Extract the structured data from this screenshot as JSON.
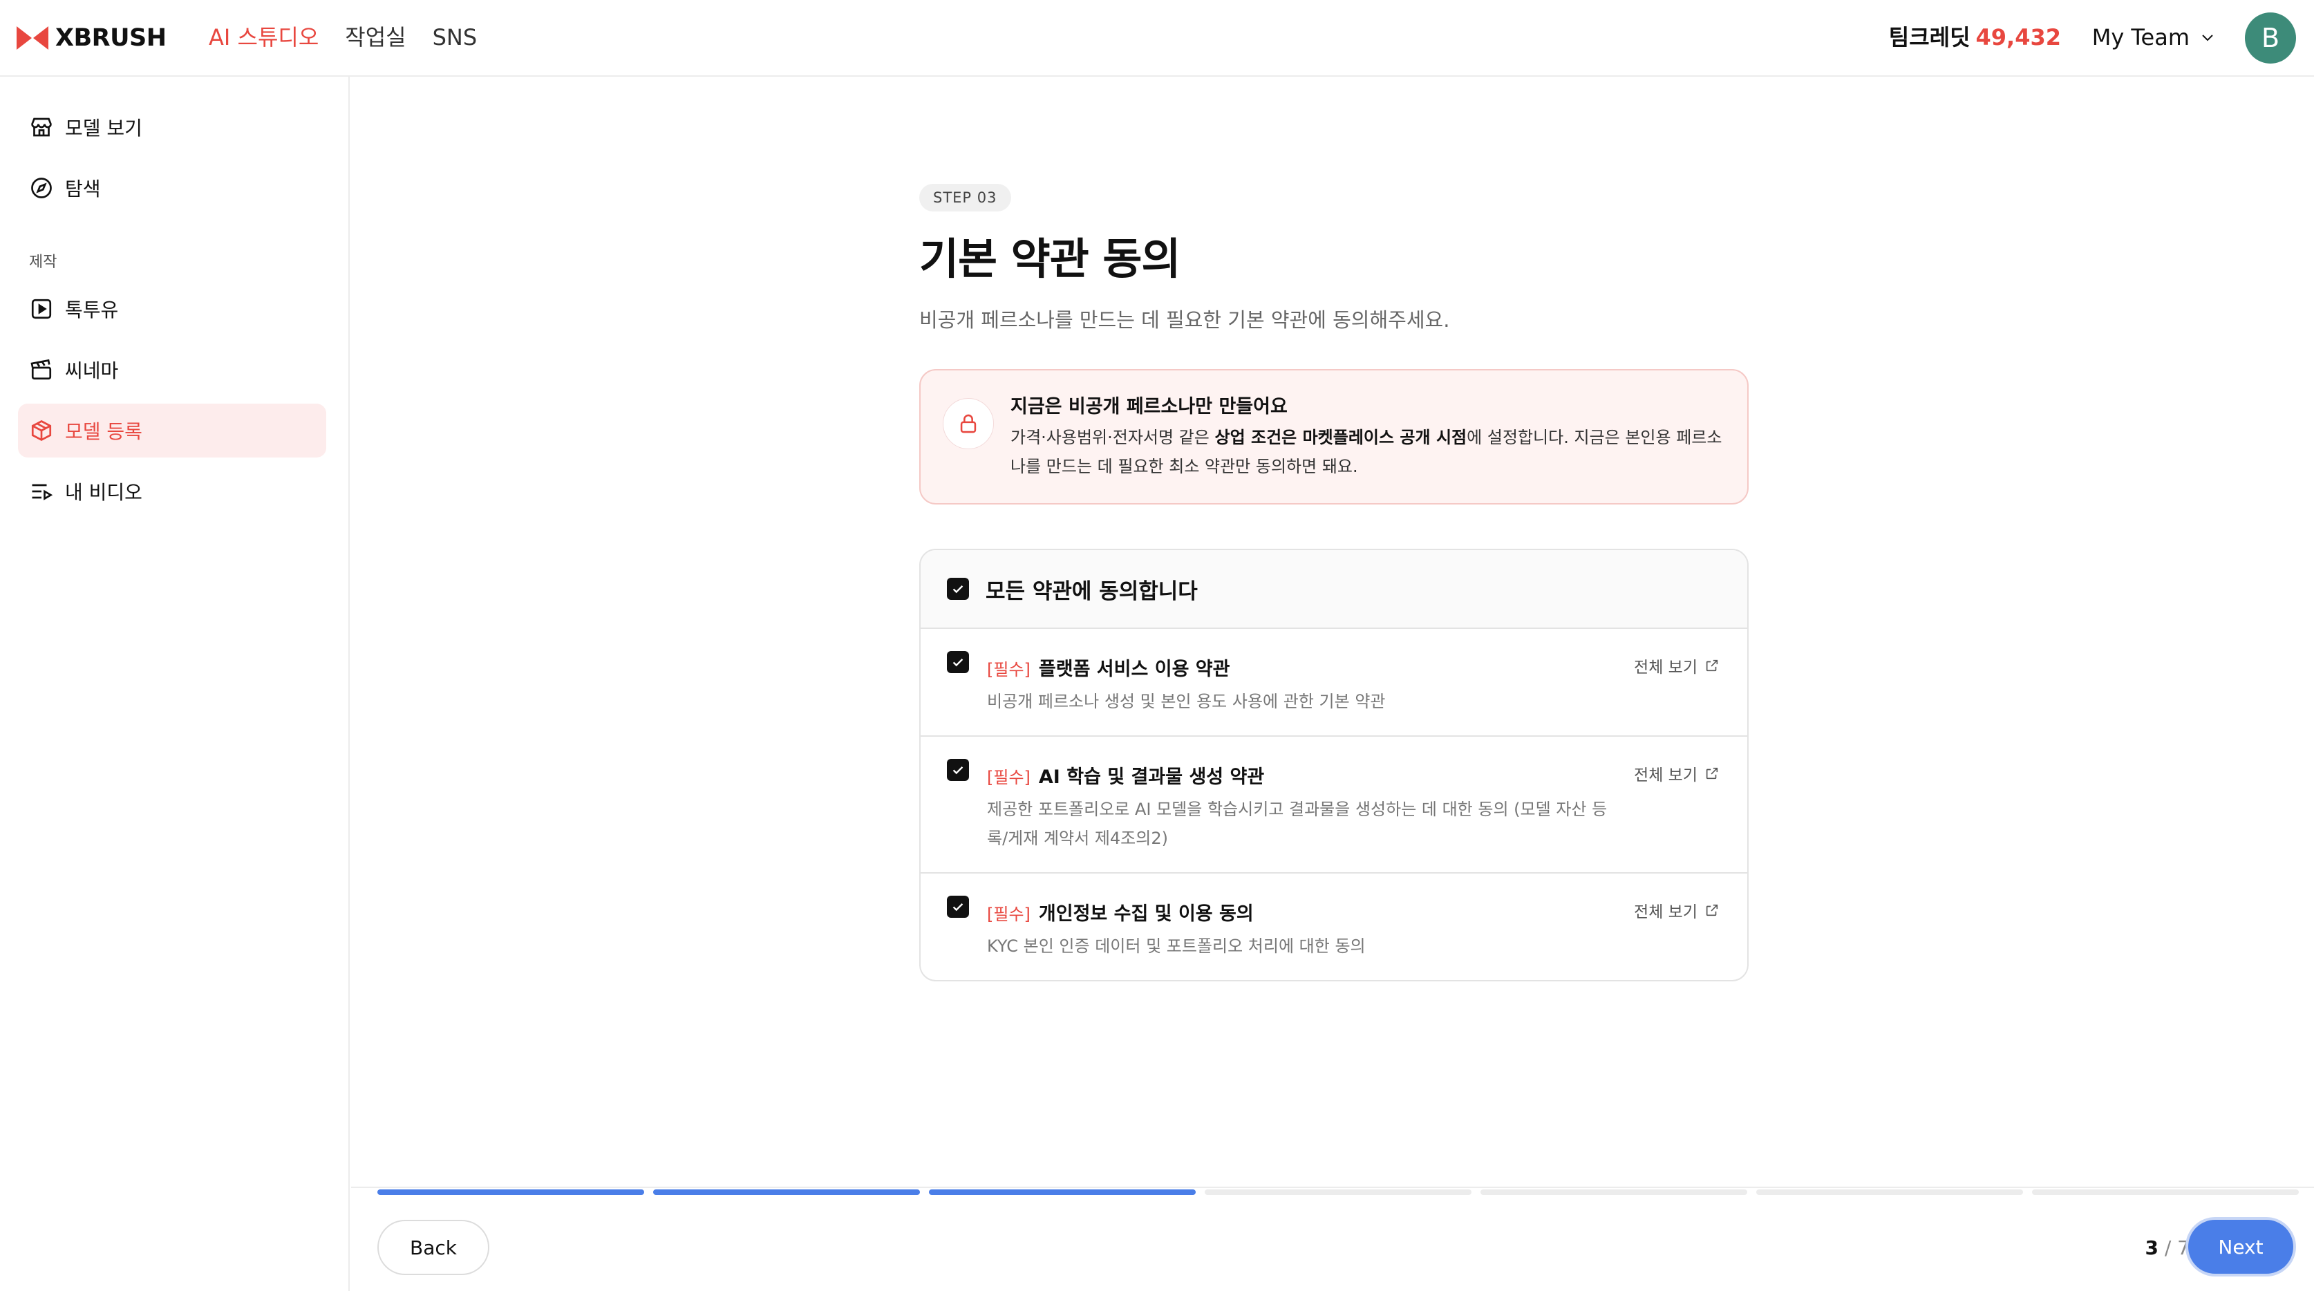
{
  "brand": {
    "name": "XBRUSH",
    "accent": "#e8473f",
    "primary": "#4a7ee8"
  },
  "header": {
    "nav": [
      {
        "label": "AI 스튜디오",
        "active": true
      },
      {
        "label": "작업실",
        "active": false
      },
      {
        "label": "SNS",
        "active": false
      }
    ],
    "credit_label": "팀크레딧",
    "credit_value": "49,432",
    "team_label": "My Team",
    "avatar_initial": "B"
  },
  "sidebar": {
    "items": [
      {
        "label": "모델 보기",
        "icon": "store-icon"
      },
      {
        "label": "탐색",
        "icon": "compass-icon"
      }
    ],
    "section_label": "제작",
    "make_items": [
      {
        "label": "톡투유",
        "icon": "play-square-icon"
      },
      {
        "label": "씨네마",
        "icon": "clapperboard-icon"
      },
      {
        "label": "모델 등록",
        "icon": "box-icon",
        "active": true
      },
      {
        "label": "내 비디오",
        "icon": "video-list-icon"
      }
    ]
  },
  "main": {
    "step_badge": "STEP 03",
    "title": "기본 약관 동의",
    "subtitle": "비공개 페르소나를 만드는 데 필요한 기본 약관에 동의해주세요.",
    "notice": {
      "title": "지금은 비공개 페르소나만 만들어요",
      "body_pre": "가격·사용범위·전자서명 같은 ",
      "body_bold": "상업 조건은 마켓플레이스 공개 시점",
      "body_post": "에 설정합니다. 지금은 본인용 페르소나를 만드는 데 필요한 최소 약관만 동의하면 돼요."
    },
    "agree_all_label": "모든 약관에 동의합니다",
    "view_all_label": "전체 보기",
    "terms": [
      {
        "required_tag": "[필수]",
        "title": "플랫폼 서비스 이용 약관",
        "desc": "비공개 페르소나 생성 및 본인 용도 사용에 관한 기본 약관",
        "checked": true
      },
      {
        "required_tag": "[필수]",
        "title": "AI 학습 및 결과물 생성 약관",
        "desc": "제공한 포트폴리오로 AI 모델을 학습시키고 결과물을 생성하는 데 대한 동의 (모델 자산 등록/게재 계약서 제4조의2)",
        "checked": true
      },
      {
        "required_tag": "[필수]",
        "title": "개인정보 수집 및 이용 동의",
        "desc": "KYC 본인 인증 데이터 및 포트폴리오 처리에 대한 동의",
        "checked": true
      }
    ]
  },
  "footer": {
    "back_label": "Back",
    "next_label": "Next",
    "current_step": "3",
    "total_steps_text": " / 7",
    "progress": {
      "total": 7,
      "done": 3
    }
  }
}
